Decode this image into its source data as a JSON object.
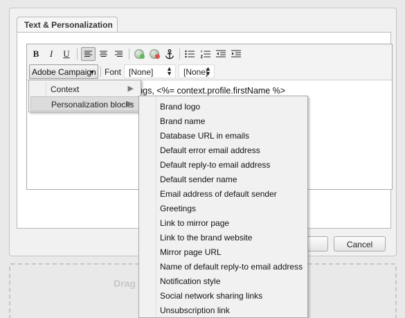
{
  "tab": {
    "label": "Text & Personalization"
  },
  "toolbar": {
    "bold_label": "B",
    "italic_label": "I",
    "underline_label": "U",
    "insert_menu_label": "Adobe Campaign",
    "font_label": "Font",
    "font_select_value": "[None]",
    "size_select_value": "[None]"
  },
  "editor": {
    "content": "etings, <%= context.profile.firstName %>"
  },
  "insert_menu": {
    "items": [
      {
        "label": "Context"
      },
      {
        "label": "Personalization blocks"
      }
    ]
  },
  "blocks_menu": {
    "items": [
      "Brand logo",
      "Brand name",
      "Database URL in emails",
      "Default error email address",
      "Default reply-to email address",
      "Default sender name",
      "Email address of default sender",
      "Greetings",
      "Link to mirror page",
      "Link to the brand website",
      "Mirror page URL",
      "Name of default reply-to email address",
      "Notification style",
      "Social network sharing links",
      "Unsubscription link"
    ]
  },
  "footer": {
    "cancel_label": "Cancel"
  },
  "dropzone": {
    "label": "Drag"
  },
  "colors": {
    "accent_red": "#d9534f",
    "accent_green": "#5cb85c",
    "menu_bg": "#f1f1f1",
    "highlight": "#dcdcdc"
  }
}
